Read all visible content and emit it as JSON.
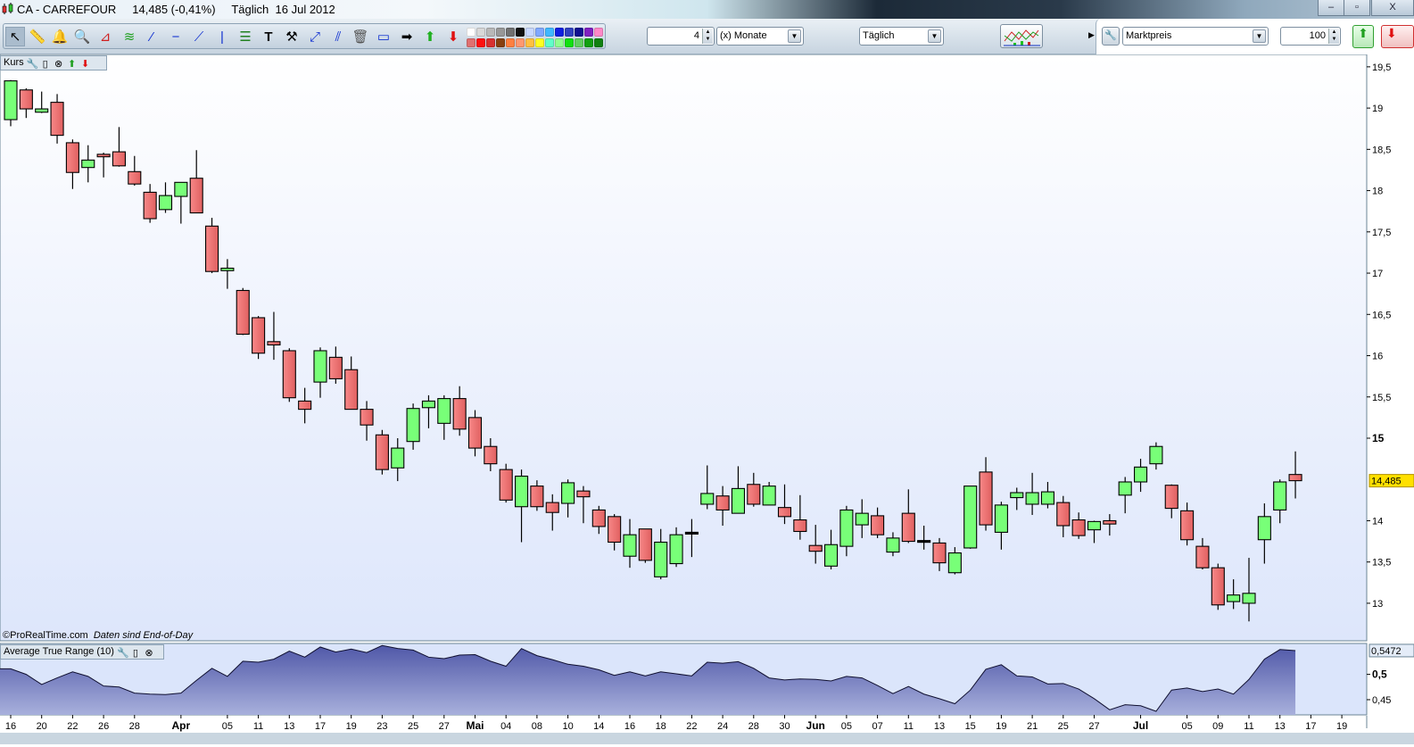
{
  "window": {
    "symbol": "CA - CARREFOUR",
    "price_change": "14,485 (-0,41%)",
    "period": "Täglich",
    "date": "16 Jul 2012",
    "minimize": "–",
    "restore": "▫",
    "close": "X"
  },
  "toolbar": {
    "tools": [
      "pointer-icon",
      "ruler-icon",
      "alert-bell-icon",
      "zoom-icon",
      "fan-icon",
      "channel-icon",
      "trendline-icon",
      "horizontal-line-icon",
      "segment-icon",
      "vertical-line-icon",
      "fibonacci-icon",
      "text-icon",
      "tools-icon",
      "extend-line-icon",
      "parallel-line-icon",
      "trash-icon",
      "rectangle-icon",
      "arrow-right-icon",
      "arrow-up-icon",
      "arrow-down-icon"
    ],
    "palette_top": [
      "#ffffff",
      "#d8d8d8",
      "#b8b8b8",
      "#989898",
      "#707070",
      "#101010",
      "#c8d8ff",
      "#80a8ff",
      "#40b8ff",
      "#1020e0",
      "#3040c0",
      "#101090",
      "#8020c0",
      "#ff88c8"
    ],
    "palette_bottom": [
      "#e07070",
      "#ff1010",
      "#d83030",
      "#884010",
      "#ff8040",
      "#ff9870",
      "#ffc040",
      "#ffff20",
      "#60ffc8",
      "#90ff90",
      "#10e010",
      "#60d060",
      "#10a010",
      "#108010"
    ],
    "units_value": "4",
    "units_select": "(x) Monate",
    "interval_select": "Täglich",
    "price_type_select": "Marktpreis",
    "bars_value": "100"
  },
  "price_panel": {
    "label": "Kurs",
    "current_price": "14,485",
    "footer_brand": "©ProRealTime.com",
    "footer_note": "Daten sind End-of-Day",
    "y_ticks": [
      {
        "v": 19.5,
        "t": "19,5"
      },
      {
        "v": 19,
        "t": "19"
      },
      {
        "v": 18.5,
        "t": "18,5"
      },
      {
        "v": 18,
        "t": "18"
      },
      {
        "v": 17.5,
        "t": "17,5"
      },
      {
        "v": 17,
        "t": "17"
      },
      {
        "v": 16.5,
        "t": "16,5"
      },
      {
        "v": 16,
        "t": "16"
      },
      {
        "v": 15.5,
        "t": "15,5"
      },
      {
        "v": 15,
        "t": "15",
        "bold": true
      },
      {
        "v": 14,
        "t": "14"
      },
      {
        "v": 13.5,
        "t": "13,5"
      },
      {
        "v": 13,
        "t": "13"
      }
    ]
  },
  "atr_panel": {
    "label": "Average True Range (10)",
    "current_value": "0,5472",
    "y_ticks": [
      {
        "v": 0.5,
        "t": "0,5",
        "bold": true
      },
      {
        "v": 0.45,
        "t": "0,45"
      }
    ]
  },
  "x_axis": [
    {
      "i": 0,
      "t": "16"
    },
    {
      "i": 2,
      "t": "20"
    },
    {
      "i": 4,
      "t": "22"
    },
    {
      "i": 6,
      "t": "26"
    },
    {
      "i": 8,
      "t": "28"
    },
    {
      "i": 11,
      "t": "Apr",
      "bold": true
    },
    {
      "i": 14,
      "t": "05"
    },
    {
      "i": 16,
      "t": "11"
    },
    {
      "i": 18,
      "t": "13"
    },
    {
      "i": 20,
      "t": "17"
    },
    {
      "i": 22,
      "t": "19"
    },
    {
      "i": 24,
      "t": "23"
    },
    {
      "i": 26,
      "t": "25"
    },
    {
      "i": 28,
      "t": "27"
    },
    {
      "i": 30,
      "t": "Mai",
      "bold": true
    },
    {
      "i": 32,
      "t": "04"
    },
    {
      "i": 34,
      "t": "08"
    },
    {
      "i": 36,
      "t": "10"
    },
    {
      "i": 38,
      "t": "14"
    },
    {
      "i": 40,
      "t": "16"
    },
    {
      "i": 42,
      "t": "18"
    },
    {
      "i": 44,
      "t": "22"
    },
    {
      "i": 46,
      "t": "24"
    },
    {
      "i": 48,
      "t": "28"
    },
    {
      "i": 50,
      "t": "30"
    },
    {
      "i": 52,
      "t": "Jun",
      "bold": true
    },
    {
      "i": 54,
      "t": "05"
    },
    {
      "i": 56,
      "t": "07"
    },
    {
      "i": 58,
      "t": "11"
    },
    {
      "i": 60,
      "t": "13"
    },
    {
      "i": 62,
      "t": "15"
    },
    {
      "i": 64,
      "t": "19"
    },
    {
      "i": 66,
      "t": "21"
    },
    {
      "i": 68,
      "t": "25"
    },
    {
      "i": 70,
      "t": "27"
    },
    {
      "i": 73,
      "t": "Jul",
      "bold": true
    },
    {
      "i": 76,
      "t": "05"
    },
    {
      "i": 78,
      "t": "09"
    },
    {
      "i": 80,
      "t": "11"
    },
    {
      "i": 82,
      "t": "13"
    },
    {
      "i": 84,
      "t": "17"
    },
    {
      "i": 86,
      "t": "19"
    }
  ],
  "chart_data": {
    "type": "candlestick",
    "ohlc": [
      [
        18.86,
        19.34,
        18.78,
        19.33
      ],
      [
        19.22,
        19.24,
        18.88,
        18.99
      ],
      [
        18.95,
        19.2,
        18.94,
        18.99
      ],
      [
        19.07,
        19.17,
        18.57,
        18.67
      ],
      [
        18.58,
        18.62,
        18.02,
        18.22
      ],
      [
        18.28,
        18.55,
        18.1,
        18.37
      ],
      [
        18.44,
        18.46,
        18.16,
        18.41
      ],
      [
        18.47,
        18.77,
        18.29,
        18.3
      ],
      [
        18.23,
        18.42,
        18.06,
        18.08
      ],
      [
        17.98,
        18.08,
        17.61,
        17.66
      ],
      [
        17.77,
        18.1,
        17.73,
        17.94
      ],
      [
        17.93,
        18.1,
        17.6,
        18.1
      ],
      [
        18.15,
        18.49,
        17.73,
        17.73
      ],
      [
        17.57,
        17.67,
        17.0,
        17.02
      ],
      [
        17.03,
        17.17,
        16.81,
        17.06
      ],
      [
        16.79,
        16.82,
        16.25,
        16.26
      ],
      [
        16.46,
        16.48,
        15.96,
        16.03
      ],
      [
        16.17,
        16.53,
        15.95,
        16.13
      ],
      [
        16.06,
        16.09,
        15.44,
        15.49
      ],
      [
        15.45,
        15.61,
        15.18,
        15.35
      ],
      [
        15.68,
        16.1,
        15.49,
        16.06
      ],
      [
        15.98,
        16.11,
        15.66,
        15.72
      ],
      [
        15.83,
        15.99,
        15.35,
        15.35
      ],
      [
        15.35,
        15.45,
        14.97,
        15.16
      ],
      [
        15.04,
        15.1,
        14.56,
        14.62
      ],
      [
        14.64,
        15.0,
        14.48,
        14.88
      ],
      [
        14.96,
        15.42,
        14.86,
        15.36
      ],
      [
        15.37,
        15.52,
        15.12,
        15.45
      ],
      [
        15.18,
        15.52,
        14.98,
        15.48
      ],
      [
        15.48,
        15.63,
        15.03,
        15.11
      ],
      [
        15.25,
        15.34,
        14.78,
        14.88
      ],
      [
        14.9,
        15.0,
        14.6,
        14.69
      ],
      [
        14.62,
        14.69,
        14.22,
        14.25
      ],
      [
        14.17,
        14.62,
        13.74,
        14.54
      ],
      [
        14.42,
        14.49,
        14.12,
        14.17
      ],
      [
        14.22,
        14.32,
        13.88,
        14.1
      ],
      [
        14.21,
        14.5,
        14.04,
        14.46
      ],
      [
        14.36,
        14.42,
        13.97,
        14.29
      ],
      [
        14.13,
        14.18,
        13.84,
        13.93
      ],
      [
        14.05,
        14.08,
        13.64,
        13.74
      ],
      [
        13.57,
        14.02,
        13.43,
        13.83
      ],
      [
        13.9,
        13.9,
        13.49,
        13.52
      ],
      [
        13.32,
        13.9,
        13.29,
        13.74
      ],
      [
        13.48,
        13.92,
        13.44,
        13.83
      ],
      [
        13.86,
        14.02,
        13.56,
        13.86
      ],
      [
        14.2,
        14.67,
        14.14,
        14.33
      ],
      [
        14.3,
        14.42,
        13.94,
        14.13
      ],
      [
        14.09,
        14.66,
        14.09,
        14.39
      ],
      [
        14.44,
        14.58,
        14.17,
        14.2
      ],
      [
        14.19,
        14.47,
        14.19,
        14.42
      ],
      [
        14.16,
        14.44,
        13.96,
        14.05
      ],
      [
        14.01,
        14.31,
        13.77,
        13.87
      ],
      [
        13.7,
        13.95,
        13.48,
        13.63
      ],
      [
        13.45,
        13.89,
        13.41,
        13.71
      ],
      [
        13.69,
        14.18,
        13.57,
        14.13
      ],
      [
        13.95,
        14.26,
        13.79,
        14.09
      ],
      [
        14.06,
        14.16,
        13.79,
        13.83
      ],
      [
        13.62,
        13.86,
        13.57,
        13.79
      ],
      [
        14.09,
        14.38,
        13.73,
        13.75
      ],
      [
        13.76,
        13.94,
        13.65,
        13.76
      ],
      [
        13.73,
        13.79,
        13.39,
        13.49
      ],
      [
        13.37,
        13.68,
        13.35,
        13.61
      ],
      [
        13.67,
        14.42,
        13.66,
        14.42
      ],
      [
        14.59,
        14.77,
        13.88,
        13.95
      ],
      [
        13.86,
        14.23,
        13.65,
        14.19
      ],
      [
        14.28,
        14.4,
        14.13,
        14.34
      ],
      [
        14.2,
        14.58,
        14.07,
        14.34
      ],
      [
        14.2,
        14.47,
        14.15,
        14.35
      ],
      [
        14.22,
        14.3,
        13.8,
        13.94
      ],
      [
        14.01,
        14.1,
        13.78,
        13.82
      ],
      [
        13.89,
        14.0,
        13.73,
        13.99
      ],
      [
        14.0,
        14.08,
        13.82,
        13.96
      ],
      [
        14.31,
        14.53,
        14.09,
        14.47
      ],
      [
        14.47,
        14.75,
        14.35,
        14.65
      ],
      [
        14.69,
        14.95,
        14.62,
        14.9
      ],
      [
        14.43,
        14.44,
        14.03,
        14.15
      ],
      [
        14.12,
        14.22,
        13.7,
        13.77
      ],
      [
        13.69,
        13.79,
        13.41,
        13.43
      ],
      [
        13.43,
        13.48,
        12.92,
        12.98
      ],
      [
        13.02,
        13.29,
        12.93,
        13.1
      ],
      [
        13.0,
        13.55,
        12.78,
        13.12
      ],
      [
        13.77,
        14.21,
        13.48,
        14.05
      ],
      [
        14.13,
        14.5,
        13.97,
        14.47
      ],
      [
        14.56,
        14.84,
        14.27,
        14.485
      ]
    ],
    "atr": [
      0.511,
      0.5,
      0.48,
      0.493,
      0.505,
      0.496,
      0.477,
      0.475,
      0.463,
      0.461,
      0.46,
      0.463,
      0.488,
      0.512,
      0.496,
      0.526,
      0.524,
      0.53,
      0.546,
      0.534,
      0.554,
      0.544,
      0.55,
      0.543,
      0.557,
      0.551,
      0.548,
      0.534,
      0.531,
      0.538,
      0.539,
      0.526,
      0.516,
      0.551,
      0.537,
      0.529,
      0.52,
      0.516,
      0.509,
      0.498,
      0.505,
      0.497,
      0.505,
      0.501,
      0.497,
      0.524,
      0.522,
      0.525,
      0.512,
      0.493,
      0.489,
      0.491,
      0.49,
      0.487,
      0.496,
      0.493,
      0.478,
      0.462,
      0.476,
      0.461,
      0.452,
      0.442,
      0.469,
      0.51,
      0.519,
      0.497,
      0.495,
      0.481,
      0.482,
      0.471,
      0.452,
      0.43,
      0.44,
      0.438,
      0.427,
      0.469,
      0.473,
      0.466,
      0.471,
      0.461,
      0.49,
      0.53,
      0.549,
      0.547
    ],
    "price_range": [
      12.545,
      19.65
    ],
    "atr_range": [
      0.42,
      0.561
    ],
    "colors": {
      "up": "#78ff78",
      "down": "#f07878",
      "atr_fill_top": "#5058a8",
      "atr_fill_bottom": "#a8b0dc",
      "current_price_bg": "#ffe000"
    }
  }
}
